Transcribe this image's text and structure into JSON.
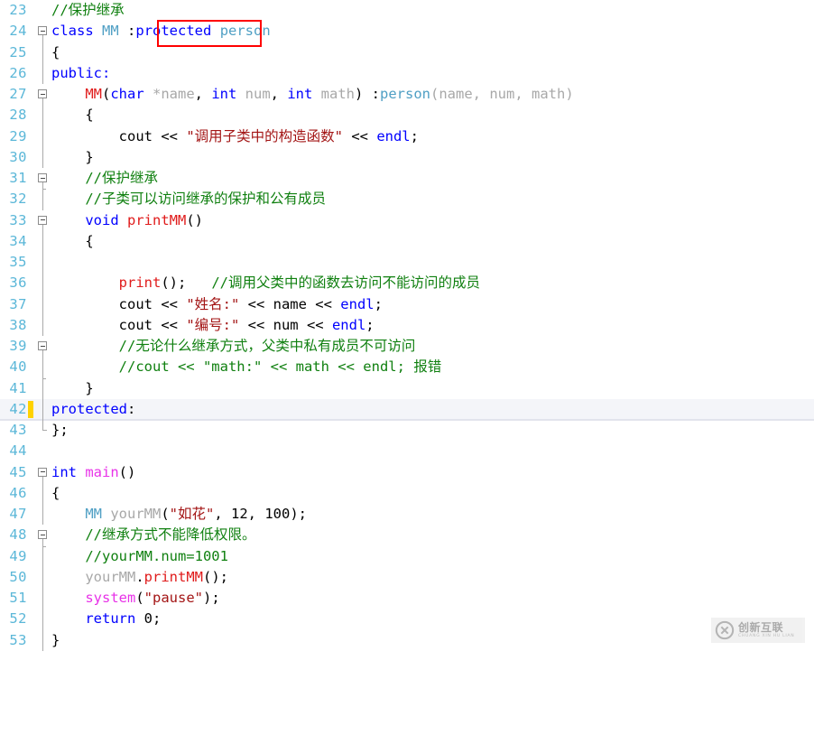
{
  "editor": {
    "first_line_number": 23,
    "current_line_number": 42,
    "language": "C++",
    "colors": {
      "background": "#ffffff",
      "line_number": "#5bb7d8",
      "comment": "#108010",
      "keyword": "#0000ff",
      "string": "#a31515",
      "function": "#e01b1b",
      "class": "#4f9fc4",
      "macro": "#e832e8",
      "variable": "#a8a8a8",
      "current_line_bg": "#f4f5f9",
      "modified_marker": "#ffd200",
      "annotation": "#ff0000"
    }
  },
  "lines": [
    {
      "n": "23",
      "fold": "none",
      "guide": "none"
    },
    {
      "n": "24",
      "fold": "box",
      "guide": "none"
    },
    {
      "n": "25",
      "fold": "none",
      "guide": "line"
    },
    {
      "n": "26",
      "fold": "none",
      "guide": "line"
    },
    {
      "n": "27",
      "fold": "box",
      "guide": "none"
    },
    {
      "n": "28",
      "fold": "none",
      "guide": "line"
    },
    {
      "n": "29",
      "fold": "none",
      "guide": "line"
    },
    {
      "n": "30",
      "fold": "none",
      "guide": "line"
    },
    {
      "n": "31",
      "fold": "box",
      "guide": "none"
    },
    {
      "n": "32",
      "fold": "none",
      "guide": "line"
    },
    {
      "n": "33",
      "fold": "box",
      "guide": "none"
    },
    {
      "n": "34",
      "fold": "none",
      "guide": "line"
    },
    {
      "n": "35",
      "fold": "none",
      "guide": "line"
    },
    {
      "n": "36",
      "fold": "none",
      "guide": "line"
    },
    {
      "n": "37",
      "fold": "none",
      "guide": "line"
    },
    {
      "n": "38",
      "fold": "none",
      "guide": "line"
    },
    {
      "n": "39",
      "fold": "box",
      "guide": "none"
    },
    {
      "n": "40",
      "fold": "none",
      "guide": "line"
    },
    {
      "n": "41",
      "fold": "none",
      "guide": "line"
    },
    {
      "n": "42",
      "fold": "none",
      "guide": "line"
    },
    {
      "n": "43",
      "fold": "none",
      "guide": "foot"
    },
    {
      "n": "44",
      "fold": "none",
      "guide": "none"
    },
    {
      "n": "45",
      "fold": "box",
      "guide": "none"
    },
    {
      "n": "46",
      "fold": "none",
      "guide": "line"
    },
    {
      "n": "47",
      "fold": "none",
      "guide": "line"
    },
    {
      "n": "48",
      "fold": "box",
      "guide": "none"
    },
    {
      "n": "49",
      "fold": "none",
      "guide": "line"
    },
    {
      "n": "50",
      "fold": "none",
      "guide": "line"
    },
    {
      "n": "51",
      "fold": "none",
      "guide": "line"
    },
    {
      "n": "52",
      "fold": "none",
      "guide": "line"
    },
    {
      "n": "53",
      "fold": "none",
      "guide": "line"
    }
  ],
  "code": {
    "l23": "//保护继承",
    "l24": {
      "kw1": "class",
      "cls": "MM",
      "colon": " :",
      "kw2": "protected",
      "base": " person"
    },
    "l25": "{",
    "l26": "public:",
    "l27": {
      "fn": "MM",
      "p1": "(",
      "kw1": "char",
      "v1": " *name",
      "p2": ", ",
      "kw2": "int",
      "v2": " num",
      "p3": ", ",
      "kw3": "int",
      "v3": " math",
      "p4": ") :",
      "base": "person",
      "args": "(name, num, math)"
    },
    "l28": "    {",
    "l29": {
      "pre": "        cout << ",
      "str": "\"调用子类中的构造函数\"",
      "mid": " << ",
      "kw": "endl",
      "end": ";"
    },
    "l31": "    //保护继承",
    "l32": "    //子类可以访问继承的保护和公有成员",
    "l33": {
      "kw": "void",
      "fn": " printMM",
      "p": "()"
    },
    "l34": "    {",
    "l36": {
      "fn": "        print",
      "p": "();  ",
      "cm": " //调用父类中的函数去访问不能访问的成员"
    },
    "l37": {
      "pre": "        cout << ",
      "str": "\"姓名:\"",
      "mid": " << name << ",
      "kw": "endl",
      "end": ";"
    },
    "l38": {
      "pre": "        cout << ",
      "str": "\"编号:\"",
      "mid": " << num << ",
      "kw": "endl",
      "end": ";"
    },
    "l39": "        //无论什么继承方式，父类中私有成员不可访问",
    "l40": "        //cout << \"math:\" << math << endl; 报错",
    "l41": "    }",
    "l42": {
      "kw": "protected",
      "end": ":"
    },
    "l43": "};",
    "l45": {
      "kw": "int",
      "fn": " main",
      "p": "()"
    },
    "l46": "{",
    "l47": {
      "cls": "    MM",
      "var": " yourMM",
      "p1": "(",
      "str": "\"如花\"",
      "p2": ", 12, 100);"
    },
    "l48": "    //继承方式不能降低权限。",
    "l49": "    //yourMM.num=1001",
    "l50": {
      "var": "    yourMM",
      "dot": ".",
      "fn": "printMM",
      "p": "();"
    },
    "l51": {
      "mag": "    system",
      "p1": "(",
      "str": "\"pause\"",
      "p2": ");"
    },
    "l52": {
      "kw": "    return",
      "end": " 0;"
    },
    "l53": "}"
  },
  "annotation": {
    "target_text": "protected",
    "shape": "rectangle"
  },
  "watermark": {
    "cn": "创新互联",
    "en": "CHUANG XIN HU LIAN"
  }
}
